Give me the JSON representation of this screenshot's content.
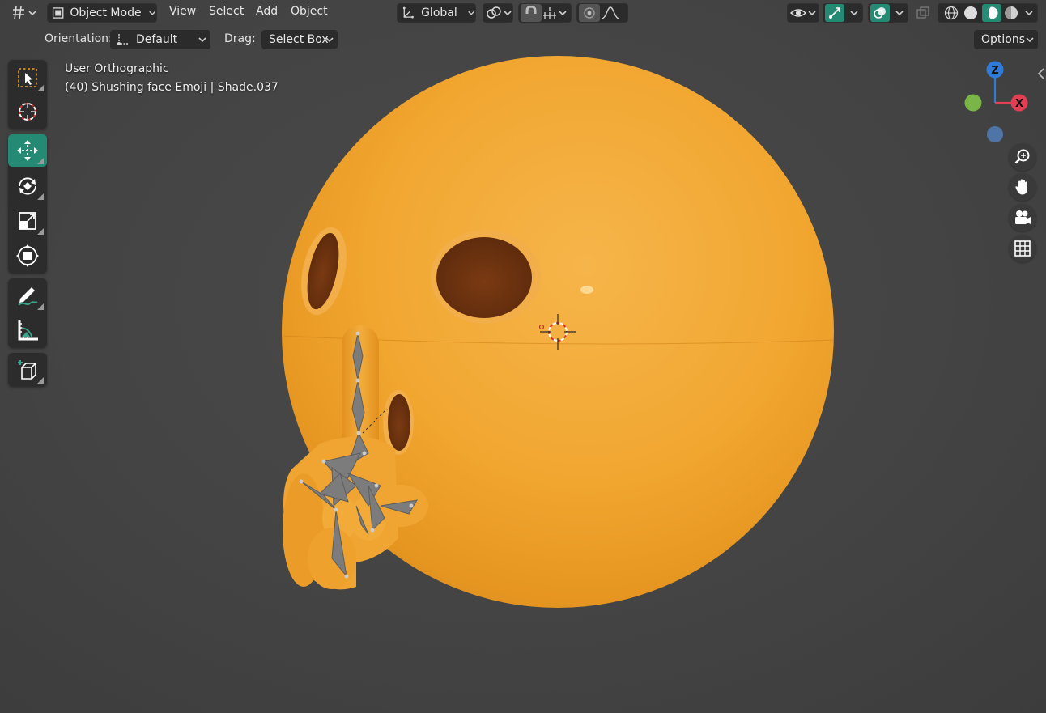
{
  "header": {
    "editor_type_icon": "viewport-icon",
    "mode_label": "Object Mode",
    "menus": [
      "View",
      "Select",
      "Add",
      "Object"
    ],
    "transform_orientation": "Global",
    "snap_icon": "magnet-icon",
    "proportional_icon": "proportional-edit-icon"
  },
  "tool_settings": {
    "orientation_label": "Orientation:",
    "orientation_value": "Default",
    "drag_label": "Drag:",
    "drag_value": "Select Box",
    "options_label": "Options"
  },
  "overlay_text": {
    "view_name": "User Orthographic",
    "object_info": "(40) Shushing face Emoji | Shade.037"
  },
  "gizmo": {
    "z_label": "Z",
    "x_label": "X",
    "colors": {
      "z": "#2f7bd7",
      "x": "#e23f55",
      "y": "#7ab548",
      "neg_z": "#4f74a6"
    }
  },
  "toolbar": {
    "tools": [
      "select-box",
      "cursor",
      "move",
      "rotate",
      "scale",
      "transform",
      "annotate",
      "measure",
      "add-cube"
    ],
    "active_tool": "move"
  },
  "colors": {
    "accent": "#258a73",
    "viewport_bg": "#444444",
    "emoji": "#f0a52a"
  }
}
